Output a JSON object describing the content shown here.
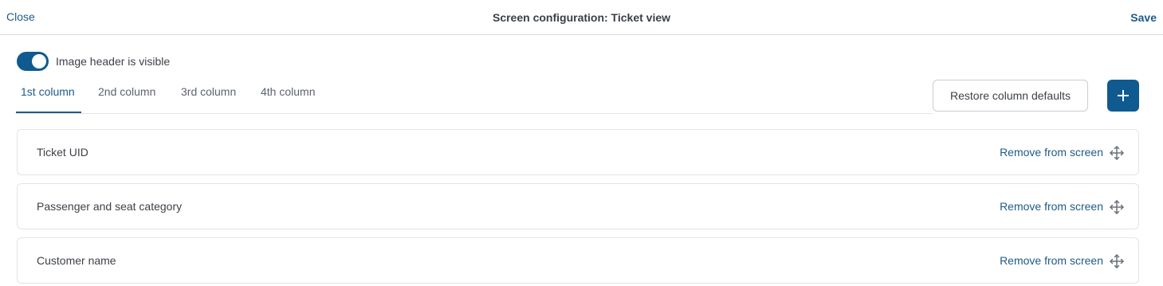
{
  "header": {
    "close_label": "Close",
    "title": "Screen configuration: Ticket view",
    "save_label": "Save"
  },
  "image_header_toggle": {
    "label": "Image header is visible",
    "checked": true
  },
  "tabs": [
    {
      "label": "1st column",
      "active": true
    },
    {
      "label": "2nd column",
      "active": false
    },
    {
      "label": "3rd column",
      "active": false
    },
    {
      "label": "4th column",
      "active": false
    }
  ],
  "actions": {
    "restore_label": "Restore column defaults",
    "add_icon": "plus-icon"
  },
  "fields": [
    {
      "label": "Ticket UID",
      "remove_label": "Remove from screen",
      "drag_icon": "move-icon"
    },
    {
      "label": "Passenger and seat category",
      "remove_label": "Remove from screen",
      "drag_icon": "move-icon"
    },
    {
      "label": "Customer name",
      "remove_label": "Remove from screen",
      "drag_icon": "move-icon"
    }
  ],
  "colors": {
    "accent": "#1e5a8a",
    "primary_button": "#0f5a8f",
    "text": "#3d4148",
    "border": "#e1e4e8"
  }
}
